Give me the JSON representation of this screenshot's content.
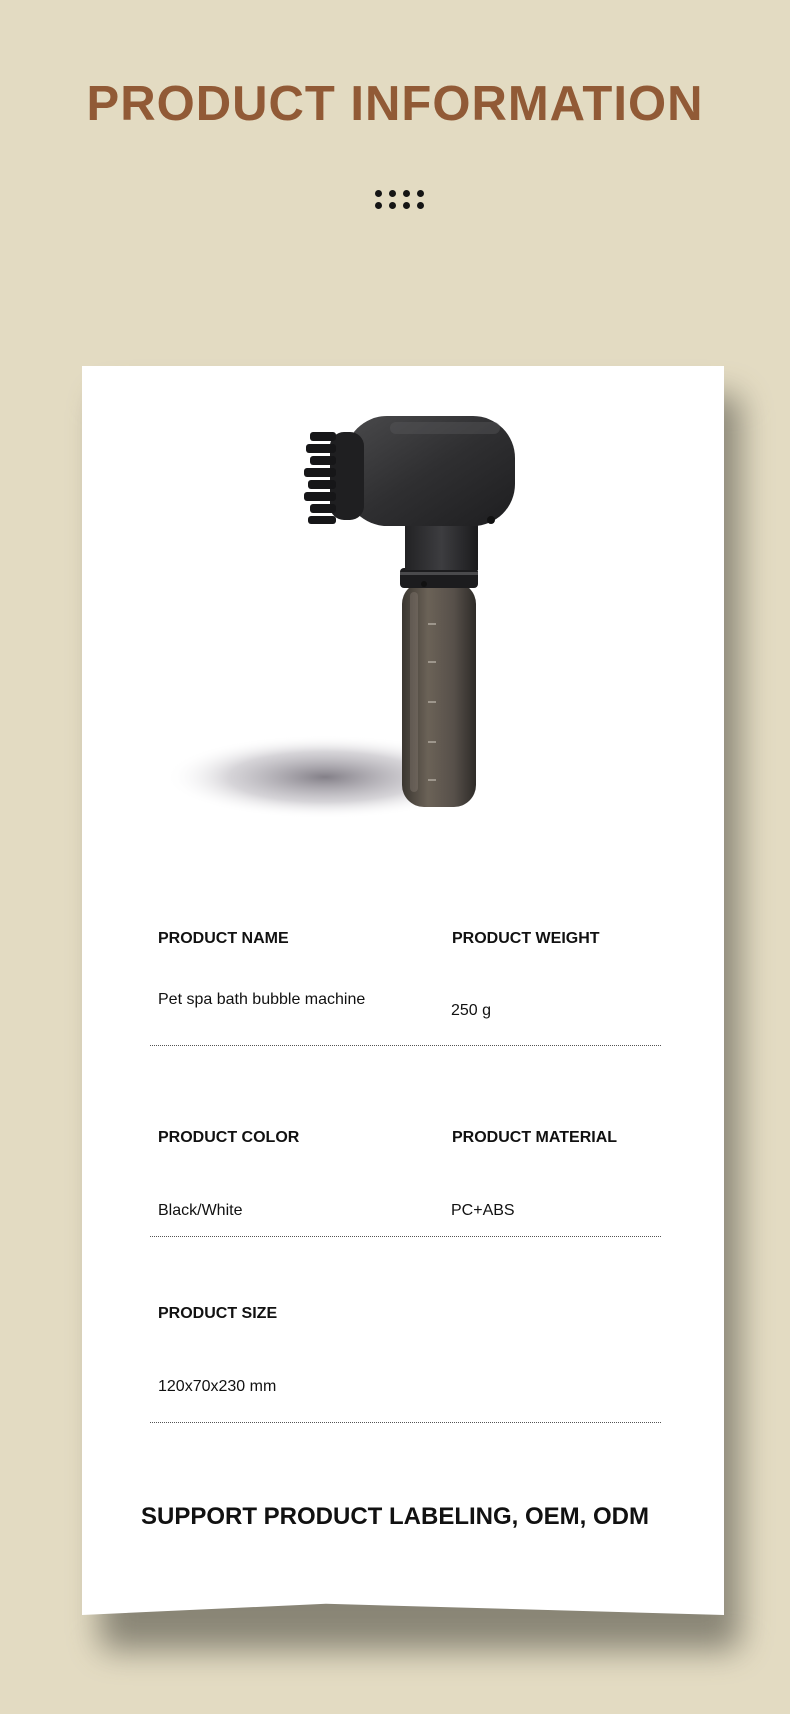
{
  "header": {
    "title": "PRODUCT INFORMATION"
  },
  "colors": {
    "background": "#e3dbc2",
    "title": "#915a36",
    "card": "#ffffff",
    "text": "#111111"
  },
  "product_image": {
    "subject": "pet spa bath bubble machine with brush head and translucent dark tank"
  },
  "specs": {
    "name": {
      "label": "PRODUCT NAME",
      "value": "Pet spa bath bubble machine"
    },
    "weight": {
      "label": "PRODUCT WEIGHT",
      "value": "250 g"
    },
    "color": {
      "label": "PRODUCT COLOR",
      "value": "Black/White"
    },
    "material": {
      "label": "PRODUCT MATERIAL",
      "value": "PC+ABS"
    },
    "size": {
      "label": "PRODUCT SIZE",
      "value": "120x70x230 mm"
    }
  },
  "footer": {
    "text": "SUPPORT PRODUCT LABELING, OEM, ODM"
  }
}
